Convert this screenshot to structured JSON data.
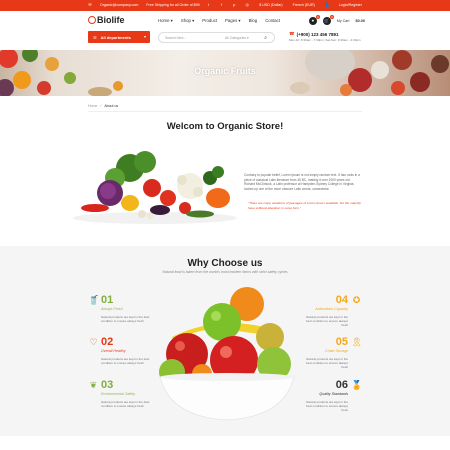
{
  "topbar": {
    "email": "Organic@company.com",
    "shipping": "Free Shipping for all Order of $99",
    "currency": "$ USD (Dollar)",
    "language": "French (EUR)",
    "login": "Login/Register",
    "social": [
      "twitter-icon",
      "facebook-icon",
      "pinterest-icon",
      "instagram-icon"
    ]
  },
  "header": {
    "logo": "Biolife",
    "nav": [
      "Home",
      "Shop",
      "Product",
      "Pages",
      "Blog",
      "Contact"
    ],
    "cart_label": "My Cart",
    "cart_total": "$0.00",
    "cart_count": "0"
  },
  "searchrow": {
    "departments_label": "All departments",
    "search_placeholder": "Search here...",
    "category_select": "All Categories",
    "phone": "(+900) 123 456 7891",
    "hours": "Mon-Fri: 8:30am - 7:30pm; Sat-Sun: 9:30am - 4:30pm"
  },
  "hero": {
    "title": "Organic Fruits"
  },
  "breadcrumb": [
    "Home",
    "About us"
  ],
  "about": {
    "heading": "Welcom to Organic Store!",
    "text": "Contrary to popular belief, Lorem Ipsum is not simply random text. It has roots in a piece of classical Latin literature from 45 BC, making it over 2000 years old. Richard McClintock, a Latin professor at Hampden-Sydney College in Virginia, looked up one of the more obscure Latin words, consectetur.",
    "quote": "\"There are many variations of passages of Lorem Ipsum available, but the majority have suffered alteration in some form.\""
  },
  "why": {
    "title": "Why Choose us",
    "subtitle": "Natural food is taken from the world's most modern farms with strict safety cycles",
    "features": [
      {
        "num": "01",
        "name": "Always Fresh",
        "desc": "Natural products are kept in the best condition to ensure always fresh"
      },
      {
        "num": "02",
        "name": "Overall Healthy",
        "desc": "Natural products are kept in the best condition to ensure always fresh"
      },
      {
        "num": "03",
        "name": "Environmental Safety",
        "desc": "Natural products are kept in the best condition to ensure always fresh"
      },
      {
        "num": "04",
        "name": "Antioxidant Capacity",
        "desc": "Natural products are kept in the best condition to ensure always fresh"
      },
      {
        "num": "05",
        "name": "Chain Storage",
        "desc": "Natural products are kept in the best condition to ensure always fresh"
      },
      {
        "num": "06",
        "name": "Quality Standards",
        "desc": "Natural products are kept in the best condition to ensure always fresh"
      }
    ]
  },
  "colors": {
    "brand": "#e73918",
    "green": "#7faf3b",
    "orange": "#f6a71a"
  }
}
